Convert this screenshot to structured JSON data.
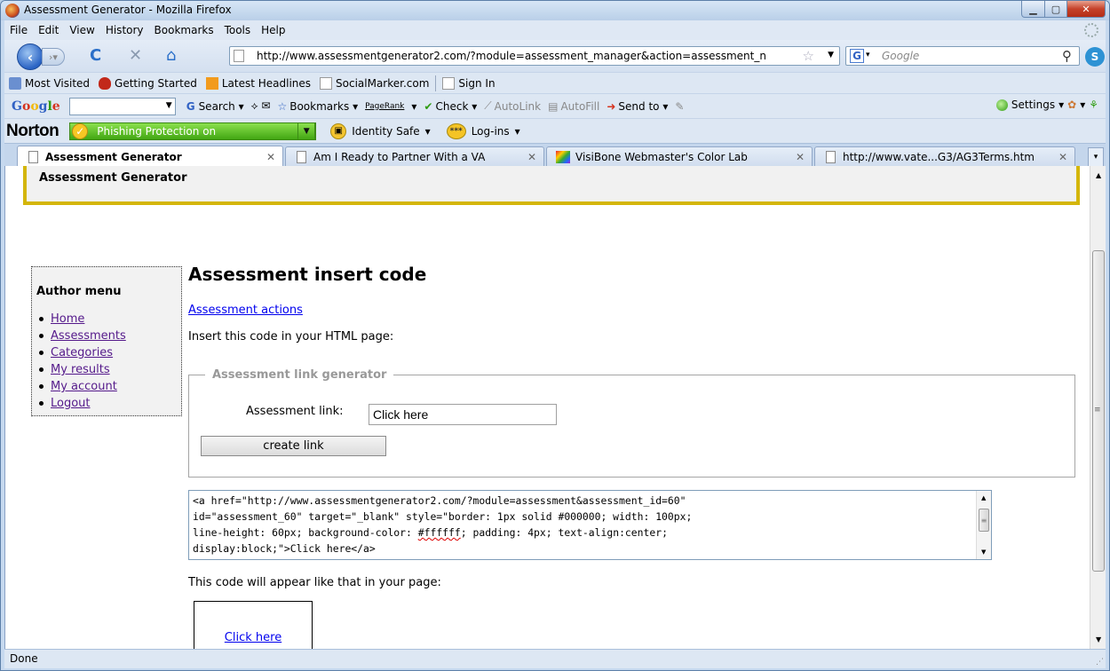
{
  "window": {
    "title": "Assessment Generator - Mozilla Firefox"
  },
  "menubar": [
    "File",
    "Edit",
    "View",
    "History",
    "Bookmarks",
    "Tools",
    "Help"
  ],
  "nav": {
    "url": "http://www.assessmentgenerator2.com/?module=assessment_manager&action=assessment_n",
    "search_placeholder": "Google"
  },
  "bookmarks": [
    "Most Visited",
    "Getting Started",
    "Latest Headlines",
    "SocialMarker.com",
    "Sign In"
  ],
  "google_toolbar": {
    "logo": "Google",
    "search": "Search",
    "bookmarks": "Bookmarks",
    "pagerank": "PageRank",
    "check": "Check",
    "autolink": "AutoLink",
    "autofill": "AutoFill",
    "sendto": "Send to",
    "settings": "Settings"
  },
  "norton": {
    "logo": "Norton",
    "phishing": "Phishing Protection on",
    "identity_safe": "Identity Safe",
    "logins": "Log-ins"
  },
  "tabs": [
    {
      "label": "Assessment Generator",
      "active": true
    },
    {
      "label": "Am I Ready to Partner With a VA",
      "active": false
    },
    {
      "label": "VisiBone Webmaster's Color Lab",
      "active": false
    },
    {
      "label": "http://www.vate...G3/AG3Terms.htm",
      "active": false
    }
  ],
  "page": {
    "site_title": "Assessment Generator",
    "author_menu": {
      "title": "Author menu",
      "items": [
        "Home",
        "Assessments",
        "Categories",
        "My results",
        "My account",
        "Logout"
      ]
    },
    "heading": "Assessment insert code",
    "actions_link": "Assessment actions",
    "insert_text": "Insert this code in your HTML page:",
    "fieldset_legend": "Assessment link generator",
    "link_label": "Assessment link:",
    "link_value": "Click here",
    "create_button": "create link",
    "code_lines": [
      "<a href=\"http://www.assessmentgenerator2.com/?module=assessment&assessment_id=60\"",
      "id=\"assessment_60\" target=\"_blank\" style=\"border: 1px solid #000000; width: 100px;",
      "line-height: 60px; background-color: ",
      "#ffffff",
      "; padding: 4px; text-align:center;",
      "display:block;\">Click here</a>"
    ],
    "appear_text": "This code will appear like that in your page:",
    "preview_link": "Click here"
  },
  "status": "Done"
}
